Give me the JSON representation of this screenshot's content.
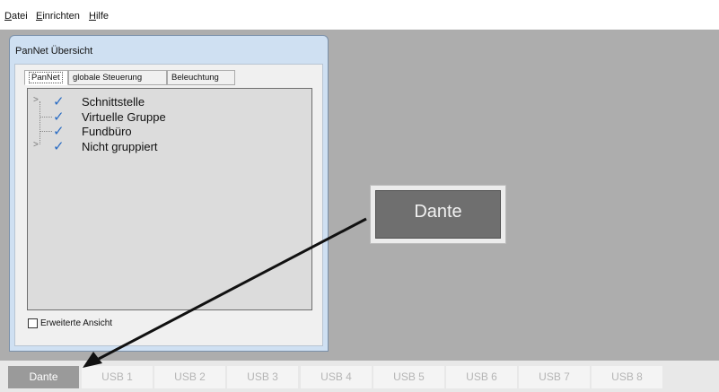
{
  "menu": {
    "items": [
      {
        "mnemonic": "D",
        "rest": "atei"
      },
      {
        "mnemonic": "E",
        "rest": "inrichten"
      },
      {
        "mnemonic": "H",
        "rest": "ilfe"
      }
    ]
  },
  "panel": {
    "title": "PanNet Übersicht",
    "tabs": [
      "PanNet",
      "globale Steuerung",
      "Beleuchtung"
    ],
    "tree": [
      {
        "label": "Schnittstelle",
        "expander": ">",
        "checked": true
      },
      {
        "label": "Virtuelle Gruppe",
        "checked": true
      },
      {
        "label": "Fundbüro",
        "checked": true
      },
      {
        "label": "Nicht gruppiert",
        "expander": ">",
        "checked": true
      }
    ],
    "checkbox_label": "Erweiterte Ansicht",
    "checkbox_checked": false
  },
  "dante_button": {
    "label": "Dante"
  },
  "bottom_tabs": {
    "active": "Dante",
    "items": [
      "Dante",
      "USB 1",
      "USB 2",
      "USB 3",
      "USB 4",
      "USB 5",
      "USB 6",
      "USB 7",
      "USB 8"
    ]
  },
  "colors": {
    "workspace": "#adadad",
    "check": "#2a6cc4",
    "active_tab": "#9a9a9a"
  },
  "icons": {
    "check": "check-icon",
    "expander": "chevron-right-icon",
    "arrow": "callout-arrow"
  }
}
